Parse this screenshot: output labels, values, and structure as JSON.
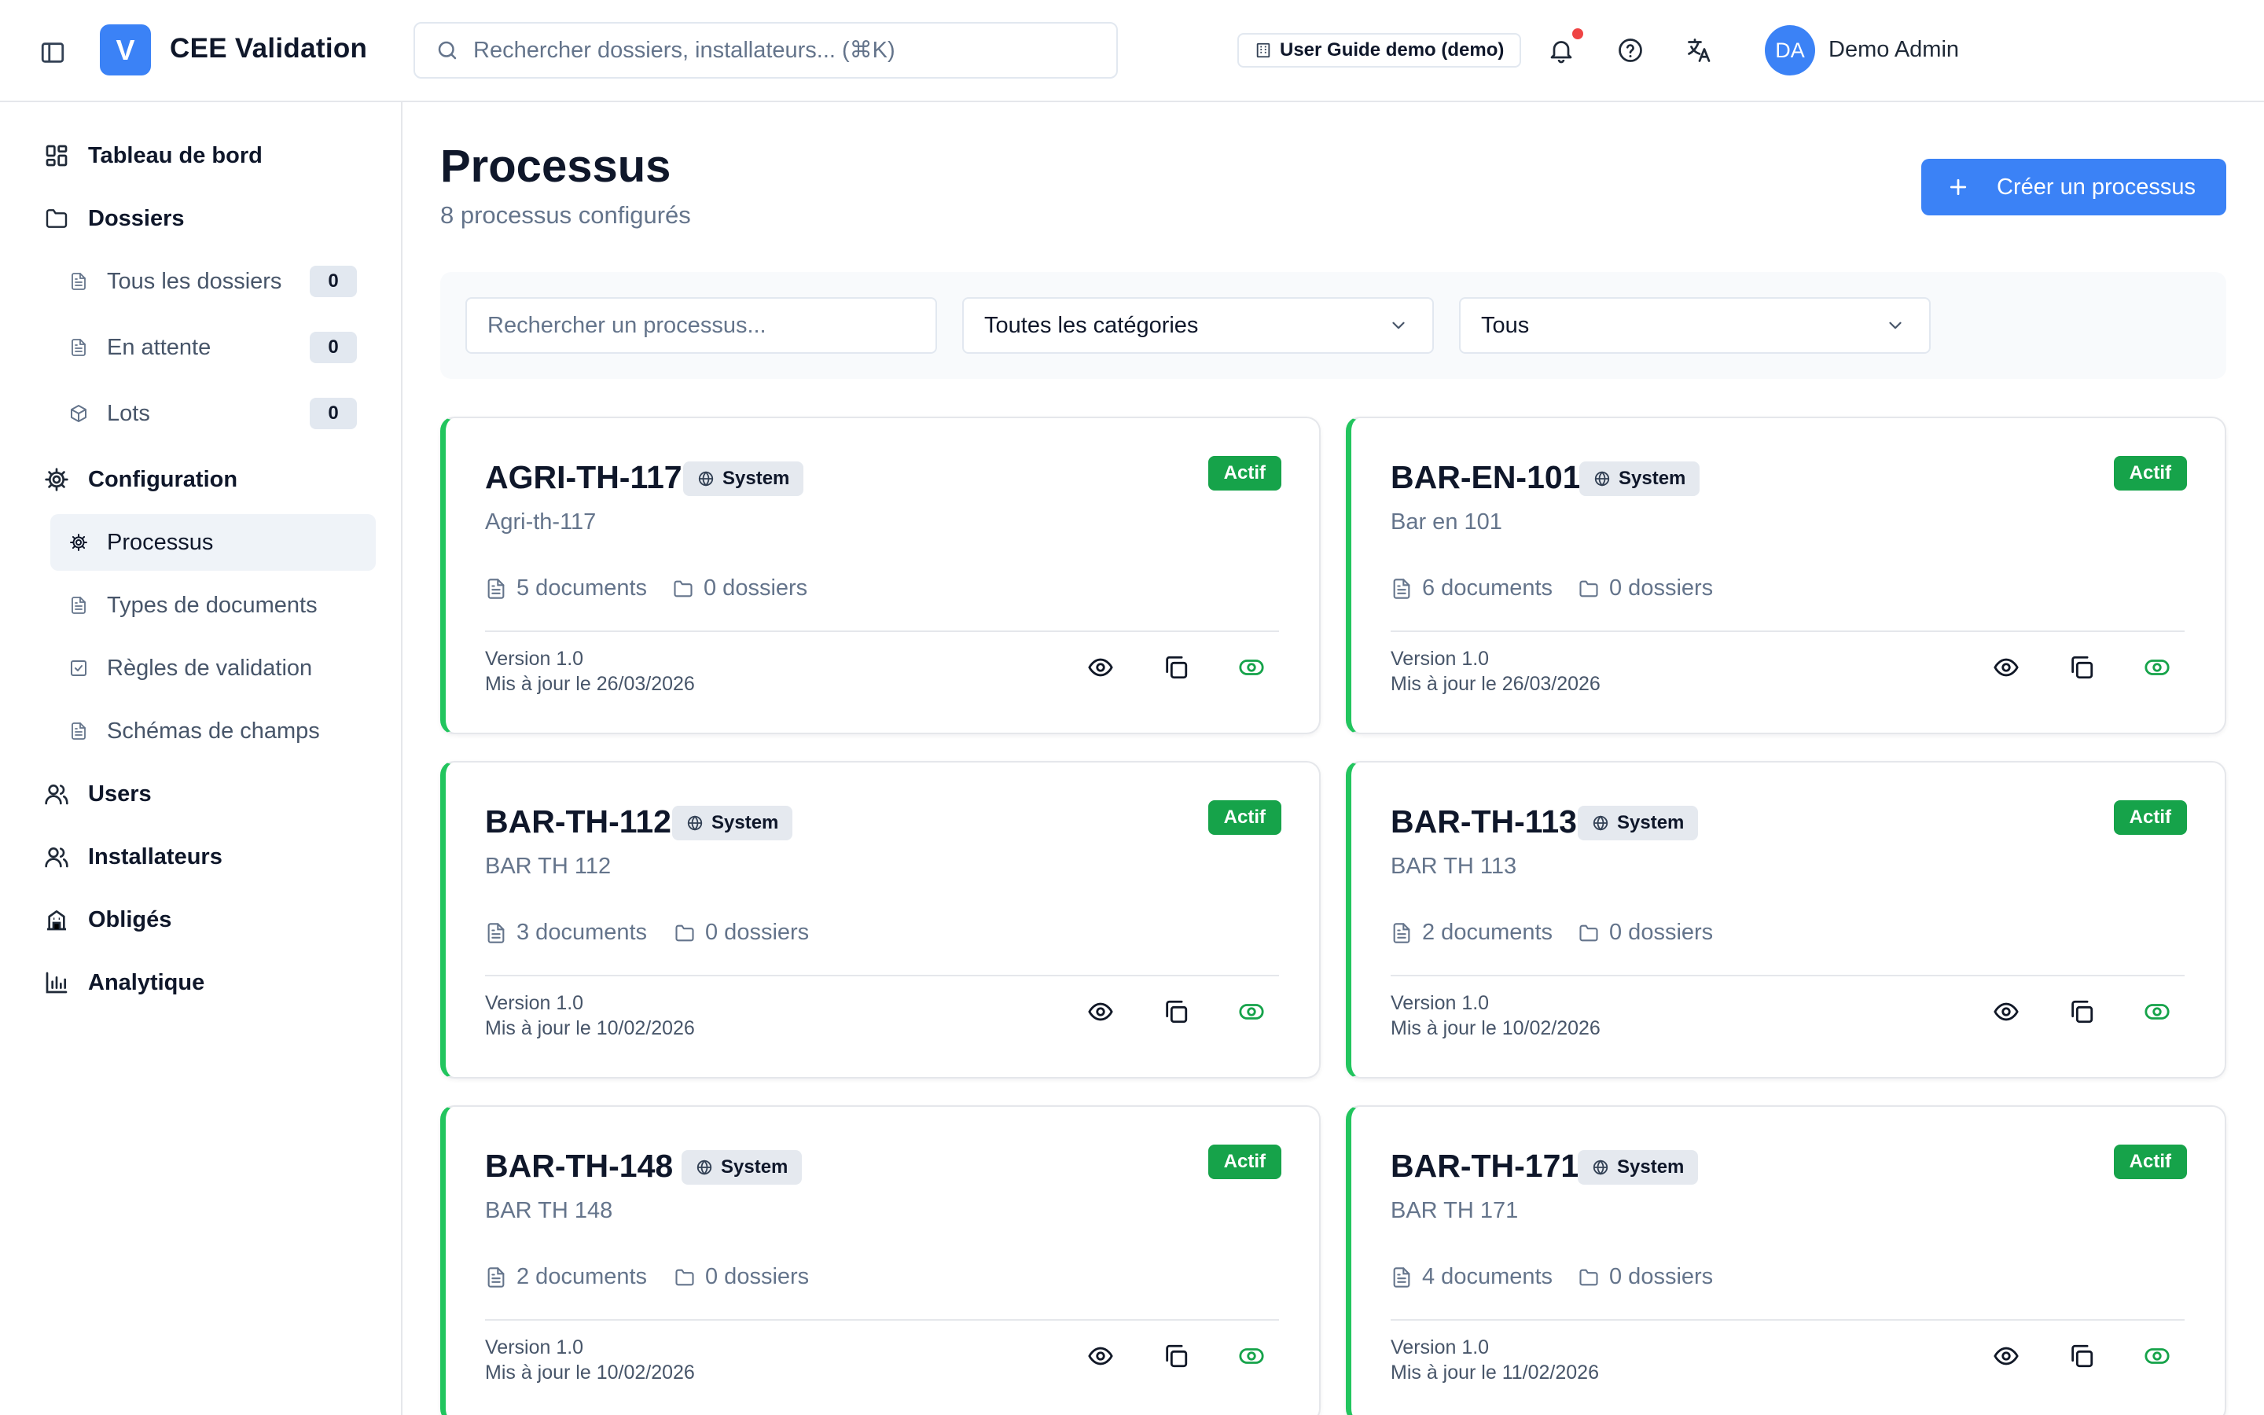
{
  "app": {
    "logo_letter": "V",
    "title": "CEE Validation",
    "search_placeholder": "Rechercher dossiers, installateurs... (⌘K)",
    "demo_badge": "User Guide demo (demo)",
    "user": {
      "initials": "DA",
      "name": "Demo Admin"
    }
  },
  "colors": {
    "accent": "#3b82f6",
    "active_green": "#16a34a",
    "card_border_green": "#22c55e",
    "notification_dot": "#ef4444"
  },
  "sidebar": {
    "dashboard": "Tableau de bord",
    "dossiers": "Dossiers",
    "all_dossiers": {
      "label": "Tous les dossiers",
      "count": "0"
    },
    "pending": {
      "label": "En attente",
      "count": "0"
    },
    "lots": {
      "label": "Lots",
      "count": "0"
    },
    "configuration": "Configuration",
    "processus": "Processus",
    "document_types": "Types de documents",
    "validation_rules": "Règles de validation",
    "field_schemas": "Schémas de champs",
    "users": "Users",
    "installers": "Installateurs",
    "obliges": "Obligés",
    "analytics": "Analytique"
  },
  "main": {
    "title": "Processus",
    "subtitle": "8 processus configurés",
    "create_button": "Créer un processus",
    "filters": {
      "search_placeholder": "Rechercher un processus...",
      "category": "Toutes les catégories",
      "status": "Tous"
    },
    "cards": [
      {
        "code": "AGRI-TH-117",
        "badge": "System",
        "status": "Actif",
        "name": "Agri-th-117",
        "documents": "5 documents",
        "dossiers": "0 dossiers",
        "version": "Version 1.0",
        "updated": "Mis à jour le 26/03/2026"
      },
      {
        "code": "BAR-EN-101",
        "badge": "System",
        "status": "Actif",
        "name": "Bar en 101",
        "documents": "6 documents",
        "dossiers": "0 dossiers",
        "version": "Version 1.0",
        "updated": "Mis à jour le 26/03/2026"
      },
      {
        "code": "BAR-TH-112",
        "badge": "System",
        "status": "Actif",
        "name": "BAR TH 112",
        "documents": "3 documents",
        "dossiers": "0 dossiers",
        "version": "Version 1.0",
        "updated": "Mis à jour le 10/02/2026"
      },
      {
        "code": "BAR-TH-113",
        "badge": "System",
        "status": "Actif",
        "name": "BAR TH 113",
        "documents": "2 documents",
        "dossiers": "0 dossiers",
        "version": "Version 1.0",
        "updated": "Mis à jour le 10/02/2026"
      },
      {
        "code": "BAR-TH-148",
        "badge": "System",
        "status": "Actif",
        "name": "BAR TH 148",
        "documents": "2 documents",
        "dossiers": "0 dossiers",
        "version": "Version 1.0",
        "updated": "Mis à jour le 10/02/2026"
      },
      {
        "code": "BAR-TH-171",
        "badge": "System",
        "status": "Actif",
        "name": "BAR TH 171",
        "documents": "4 documents",
        "dossiers": "0 dossiers",
        "version": "Version 1.0",
        "updated": "Mis à jour le 11/02/2026"
      }
    ]
  }
}
